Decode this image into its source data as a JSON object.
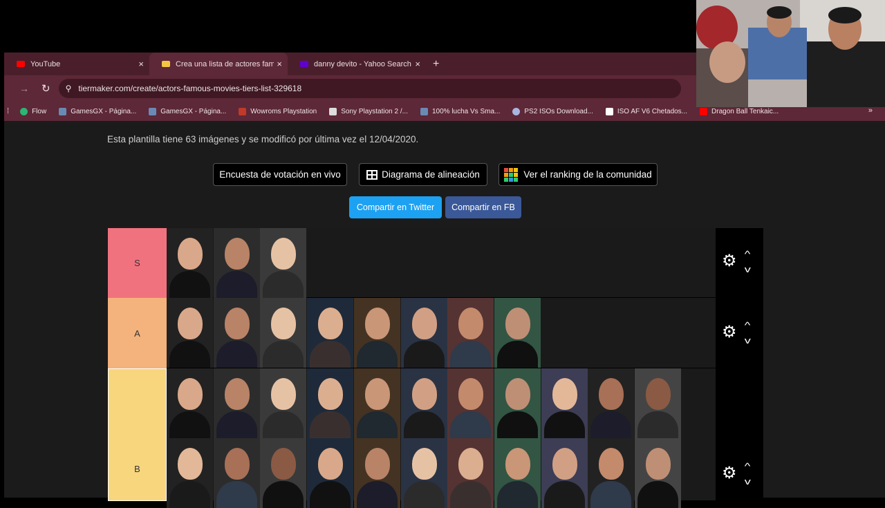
{
  "browser": {
    "tabs": [
      {
        "title": "YouTube",
        "favicon_color": "#ff0000",
        "active": false
      },
      {
        "title": "Crea una lista de actores famo",
        "favicon_color": "#f5c542",
        "active": true
      },
      {
        "title": "danny devito - Yahoo Search T",
        "favicon_color": "#6001d2",
        "active": false
      }
    ],
    "tab_close_glyph": "×",
    "new_tab_glyph": "+",
    "url": "tiermaker.com/create/actors-famous-movies-tiers-list-329618",
    "bookmarks": [
      {
        "label": "Flow",
        "color": "#2bb673"
      },
      {
        "label": "GamesGX - Página...",
        "color": "#6a8ab5"
      },
      {
        "label": "GamesGX - Página...",
        "color": "#6a8ab5"
      },
      {
        "label": "Wowroms Playstation",
        "color": "#c0392b"
      },
      {
        "label": "Sony Playstation 2 /...",
        "color": "#dddddd"
      },
      {
        "label": "100% lucha Vs Sma...",
        "color": "#6a8ab5"
      },
      {
        "label": "PS2 ISOs Download...",
        "color": "#aab4e0"
      },
      {
        "label": "ISO AF V6 Chetados...",
        "color": "#ffffff"
      },
      {
        "label": "Dragon Ball Tenkaic...",
        "color": "#ff0000"
      }
    ],
    "bookmarks_more": "»"
  },
  "page": {
    "info_text": "Esta plantilla tiene 63 imágenes y se modificó por última vez el 12/04/2020.",
    "btn_live_poll": "Encuesta de votación en vivo",
    "btn_alignment": "Diagrama de alineación",
    "btn_community": "Ver el ranking de la comunidad",
    "btn_twitter": "Compartir en Twitter",
    "btn_fb": "Compartir en FB",
    "twitter_color": "#1da1f2",
    "fb_color": "#3b5998"
  },
  "tiers": [
    {
      "label": "S",
      "color": "#f1727f",
      "count": 3
    },
    {
      "label": "A",
      "color": "#f4b27c",
      "count": 8
    },
    {
      "label": "",
      "color": "#f8d67e",
      "count": 11
    },
    {
      "label": "B",
      "color": "#f8d67e",
      "count": 11
    }
  ],
  "controls": {
    "gear": "⚙",
    "up": "^",
    "down": "v"
  }
}
